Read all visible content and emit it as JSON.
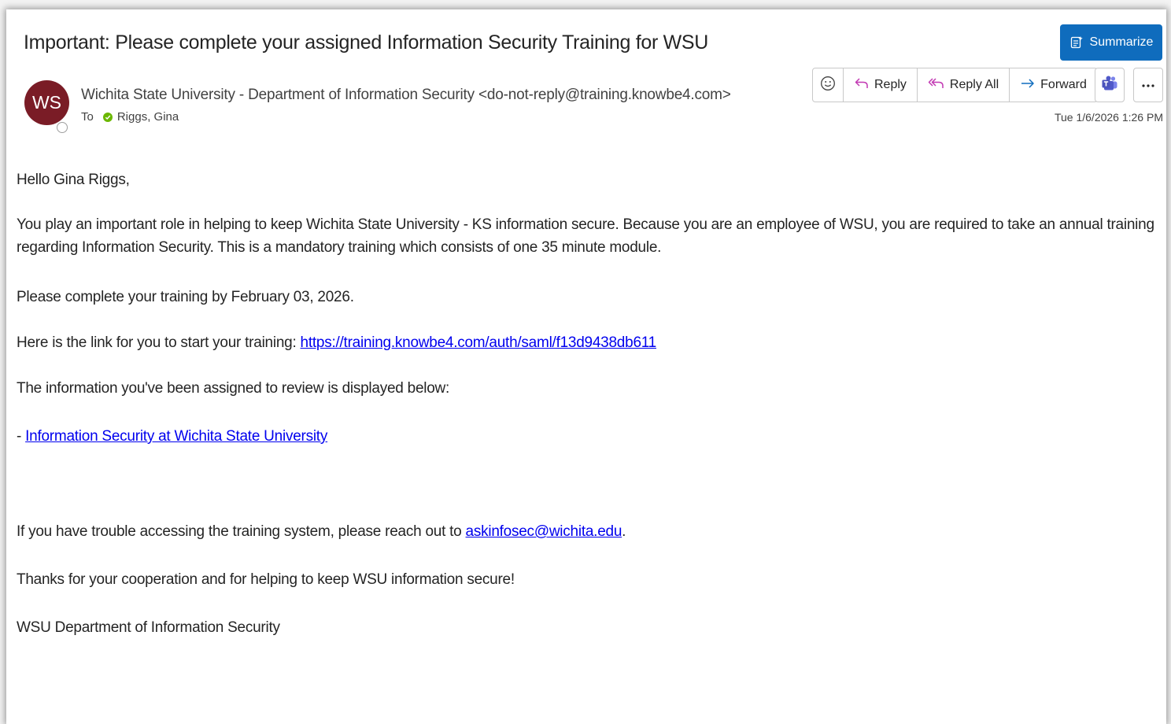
{
  "email": {
    "subject": "Important: Please complete your assigned Information Security Training for WSU",
    "summarize_label": "Summarize",
    "avatar_initials": "WS",
    "sender": "Wichita State University - Department of Information Security <do-not-reply@training.knowbe4.com>",
    "to_label": "To",
    "recipient": "Riggs, Gina",
    "timestamp": "Tue 1/6/2026 1:26 PM"
  },
  "actions": {
    "reply_label": "Reply",
    "reply_all_label": "Reply All",
    "forward_label": "Forward"
  },
  "body": {
    "greeting": "Hello Gina Riggs,",
    "paragraph1": "You play an important role in helping to keep Wichita State University - KS information secure. Because you are an employee of WSU, you are required to take an annual training regarding Information Security. This is a mandatory training which consists of one 35 minute module.",
    "deadline": "Please complete your training by February 03, 2026.",
    "link_intro": "Here is the link for you to start your training: ",
    "training_link": "https://training.knowbe4.com/auth/saml/f13d9438db611",
    "assigned_intro": "The information you've been assigned to review is displayed below:",
    "list_dash": "- ",
    "module_link": "Information Security at Wichita State University",
    "trouble_text": "If you have trouble accessing the training system, please reach out to ",
    "support_email": "askinfosec@wichita.edu",
    "trouble_end": ".",
    "thanks": "Thanks for your cooperation and for helping to keep WSU information secure!",
    "signature": "WSU Department of Information Security"
  },
  "icons": {
    "summarize": "summarize-icon",
    "emoji": "emoji-icon",
    "reply": "reply-icon",
    "reply_all": "reply-all-icon",
    "forward": "forward-icon",
    "teams": "teams-icon",
    "more": "more-icon"
  },
  "colors": {
    "accent": "#0f6cbd",
    "avatar": "#7a1c26",
    "reply_arrow": "#c239b3",
    "forward_arrow": "#0f6cbd",
    "presence_available": "#6bb700",
    "link": "#0000ee"
  }
}
